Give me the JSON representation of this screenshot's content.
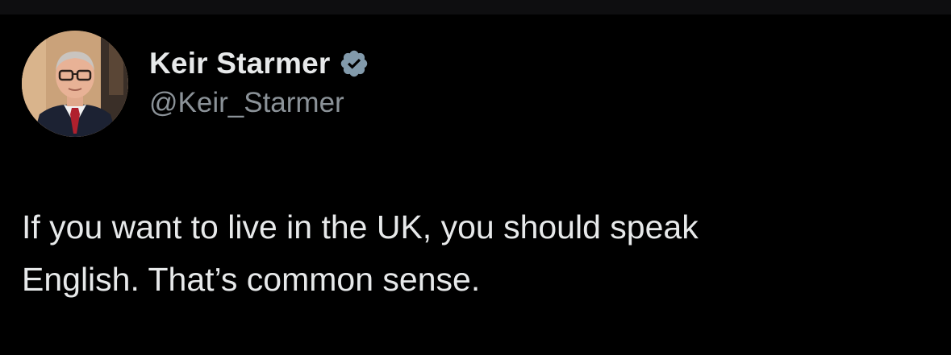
{
  "author": {
    "display_name": "Keir Starmer",
    "handle": "@Keir_Starmer",
    "verified": true,
    "verified_icon": "verified-badge-icon",
    "verified_color": "#829aab"
  },
  "tweet": {
    "line1": "If you want to live in the UK, you should speak",
    "line2": "English. That’s common sense."
  },
  "colors": {
    "background": "#000000",
    "primary_text": "#e7e9ea",
    "secondary_text": "#8b9298"
  }
}
